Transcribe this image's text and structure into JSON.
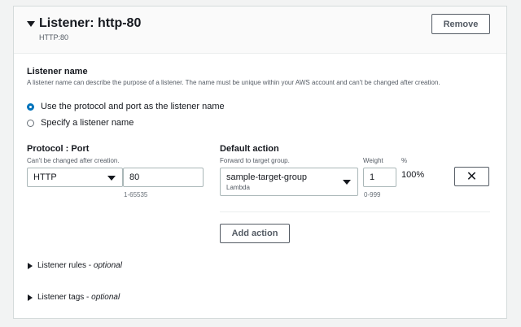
{
  "listener": {
    "title": "Listener: http-80",
    "subtitle": "HTTP:80",
    "remove_label": "Remove"
  },
  "listener_name": {
    "label": "Listener name",
    "description": "A listener name can describe the purpose of a listener. The name must be unique within your AWS account and can't be changed after creation.",
    "options": [
      {
        "label": "Use the protocol and port as the listener name",
        "checked": true
      },
      {
        "label": "Specify a listener name",
        "checked": false
      }
    ]
  },
  "protocol_port": {
    "label": "Protocol : Port",
    "description": "Can't be changed after creation.",
    "protocol_value": "HTTP",
    "port_value": "80",
    "port_hint": "1-65535"
  },
  "default_action": {
    "label": "Default action",
    "description": "Forward to target group.",
    "target_group": "sample-target-group",
    "target_type": "Lambda",
    "weight_label": "Weight",
    "weight_value": "1",
    "weight_hint": "0-999",
    "percent_label": "%",
    "percent_value": "100%",
    "add_action_label": "Add action"
  },
  "expanders": {
    "rules": {
      "label": "Listener rules - ",
      "optional": "optional"
    },
    "tags": {
      "label": "Listener tags - ",
      "optional": "optional"
    }
  },
  "colors": {
    "accent": "#0073bb",
    "border": "#545b64"
  }
}
